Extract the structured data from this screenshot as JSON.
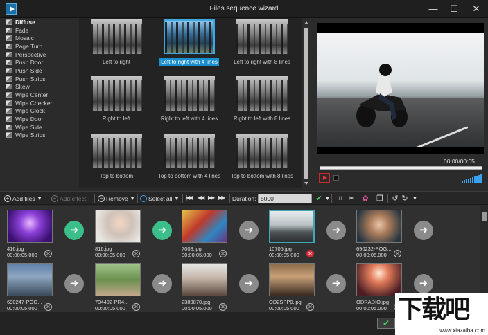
{
  "window": {
    "title": "Files sequence wizard"
  },
  "effects": [
    {
      "label": "Diffuse",
      "selected": true
    },
    {
      "label": "Fade"
    },
    {
      "label": "Mosaic"
    },
    {
      "label": "Page Turn"
    },
    {
      "label": "Perspective"
    },
    {
      "label": "Push Door"
    },
    {
      "label": "Push Side"
    },
    {
      "label": "Push Strips"
    },
    {
      "label": "Skew"
    },
    {
      "label": "Wipe Center"
    },
    {
      "label": "Wipe Checker"
    },
    {
      "label": "Wipe Clock"
    },
    {
      "label": "Wipe Door"
    },
    {
      "label": "Wipe Side"
    },
    {
      "label": "Wipe Strips"
    }
  ],
  "thumbnails": [
    {
      "label": "Left to right"
    },
    {
      "label": "Left to right with 4 lines",
      "selected": true
    },
    {
      "label": "Left to right with 8 lines"
    },
    {
      "label": "Right to left"
    },
    {
      "label": "Right to left with 4 lines"
    },
    {
      "label": "Right to left with 8 lines"
    },
    {
      "label": "Top to bottom"
    },
    {
      "label": "Top to bottom with 4 lines"
    },
    {
      "label": "Top to bottom with 8 lines"
    }
  ],
  "preview": {
    "time": "00:00/00:05"
  },
  "toolbar": {
    "add_files": "Add files",
    "add_effect": "Add effect",
    "remove": "Remove",
    "select_all": "Select all",
    "duration_label": "Duration:",
    "duration_value": "5000"
  },
  "timeline": [
    {
      "name": "416.jpg",
      "duration": "00:00:05.000",
      "photo": "p1",
      "transition": "green"
    },
    {
      "name": "816.jpg",
      "duration": "00:00:05.000",
      "photo": "p2",
      "transition": "green"
    },
    {
      "name": "7008.jpg",
      "duration": "00:00:05.000",
      "photo": "p3",
      "transition": "gray"
    },
    {
      "name": "10705.jpg",
      "duration": "00:00:05.000",
      "photo": "p4",
      "transition": "gray",
      "selected": true
    },
    {
      "name": "690232-POG...",
      "duration": "00:00:05.000",
      "photo": "p5",
      "transition": "gray"
    },
    {
      "name": "690247-POG...",
      "duration": "00:00:05.000",
      "photo": "p6",
      "transition": "gray"
    },
    {
      "name": "704402-PR4...",
      "duration": "00:00:05.000",
      "photo": "p7",
      "transition": "gray"
    },
    {
      "name": "2389870.jpg",
      "duration": "00:00:05.000",
      "photo": "p8",
      "transition": "gray"
    },
    {
      "name": "OD2SPP0.jpg",
      "duration": "00:00:05.000",
      "photo": "p9",
      "transition": "gray"
    },
    {
      "name": "ODRADIO.jpg",
      "duration": "00:00:05.000",
      "photo": "p10",
      "transition": "gray"
    }
  ],
  "watermark": {
    "text": "下载吧",
    "url": "www.xiazaiba.com"
  }
}
